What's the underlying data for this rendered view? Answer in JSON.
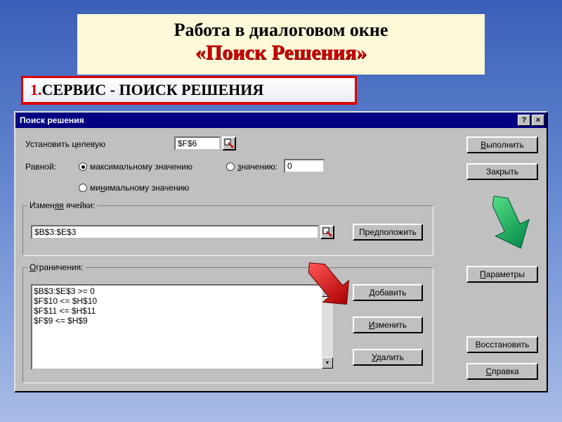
{
  "slide": {
    "title_line1": "Работа в диалоговом окне",
    "title_line2": "«Поиск Решения»",
    "step_num": "1.",
    "step_text": "СЕРВИС - ПОИСК РЕШЕНИЯ"
  },
  "dialog": {
    "title": "Поиск решения",
    "help_btn": "?",
    "close_btn": "×",
    "labels": {
      "target": "Установить целевую",
      "equal": "Равной:",
      "max": "максимальному значению",
      "min": "минимальному значению",
      "value": "значению:",
      "changing": "Изменяя ячейки:",
      "constraints": "Ограничения:"
    },
    "fields": {
      "target_cell": "$F$6",
      "value": "0",
      "changing_cells": "$B$3:$E$3"
    },
    "constraints": [
      "$B$3:$E$3 >= 0",
      "$F$10 <= $H$10",
      "$F$11 <= $H$11",
      "$F$9 <= $H$9"
    ],
    "buttons": {
      "execute": "Выполнить",
      "close": "Закрыть",
      "params": "Параметры",
      "restore": "Восстановить",
      "help": "Справка",
      "guess": "Предположить",
      "add": "Добавить",
      "change": "Изменить",
      "delete": "Удалить"
    }
  }
}
